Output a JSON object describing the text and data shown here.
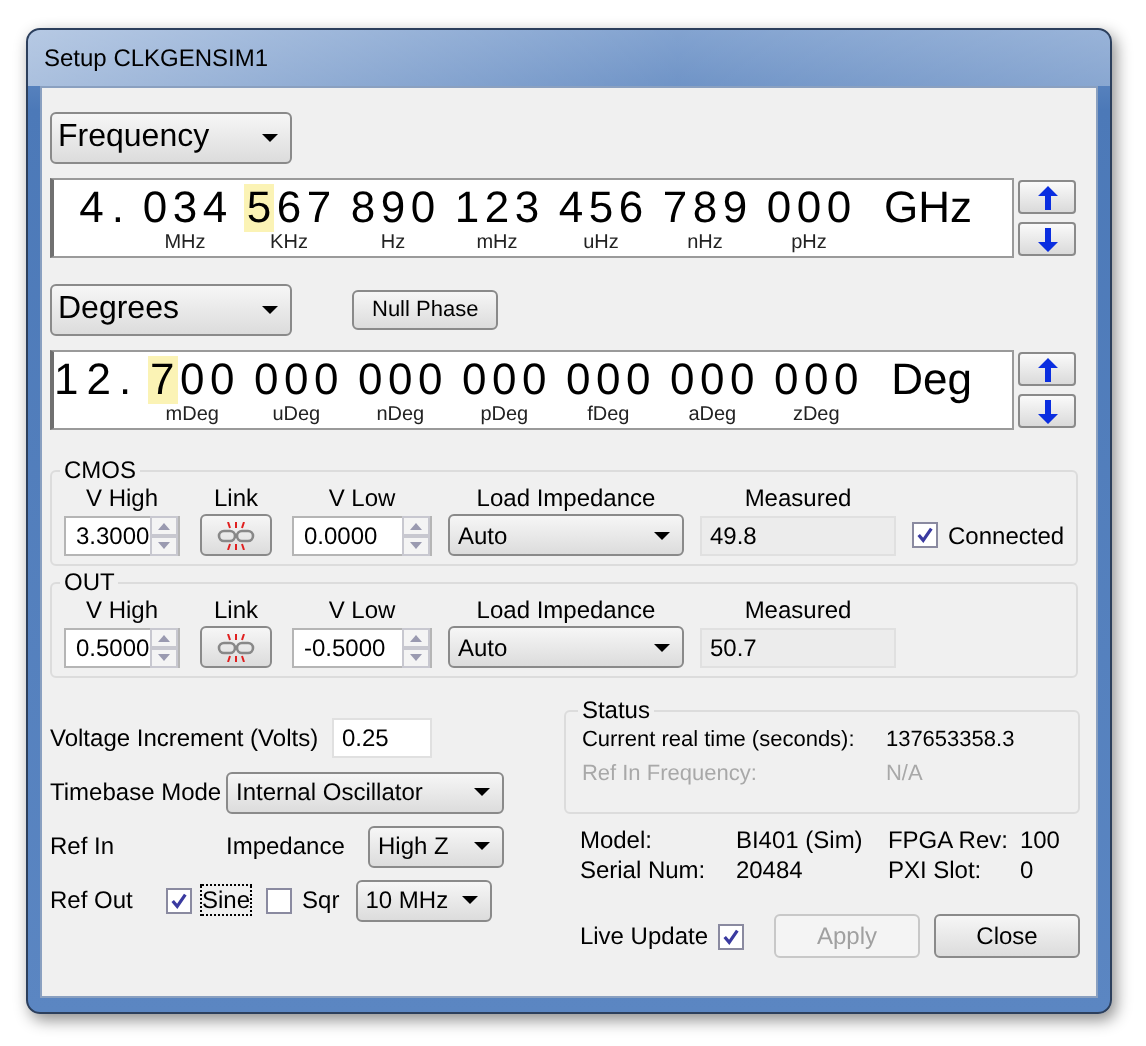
{
  "window": {
    "title": "Setup CLKGENSIM1"
  },
  "frequency": {
    "mode": "Frequency",
    "display": {
      "lead": "4.",
      "suffix": "GHz",
      "groups": [
        {
          "unit": "MHz",
          "digits": [
            {
              "d": "0",
              "selected": false
            },
            {
              "d": "3",
              "selected": false
            },
            {
              "d": "4",
              "selected": false
            }
          ]
        },
        {
          "unit": "KHz",
          "digits": [
            {
              "d": "5",
              "selected": true
            },
            {
              "d": "6",
              "selected": false
            },
            {
              "d": "7",
              "selected": false
            }
          ]
        },
        {
          "unit": "Hz",
          "digits": [
            {
              "d": "8",
              "selected": false
            },
            {
              "d": "9",
              "selected": false
            },
            {
              "d": "0",
              "selected": false
            }
          ]
        },
        {
          "unit": "mHz",
          "digits": [
            {
              "d": "1",
              "selected": false
            },
            {
              "d": "2",
              "selected": false
            },
            {
              "d": "3",
              "selected": false
            }
          ]
        },
        {
          "unit": "uHz",
          "digits": [
            {
              "d": "4",
              "selected": false
            },
            {
              "d": "5",
              "selected": false
            },
            {
              "d": "6",
              "selected": false
            }
          ]
        },
        {
          "unit": "nHz",
          "digits": [
            {
              "d": "7",
              "selected": false
            },
            {
              "d": "8",
              "selected": false
            },
            {
              "d": "9",
              "selected": false
            }
          ]
        },
        {
          "unit": "pHz",
          "digits": [
            {
              "d": "0",
              "selected": false
            },
            {
              "d": "0",
              "selected": false
            },
            {
              "d": "0",
              "selected": false
            }
          ]
        }
      ]
    }
  },
  "phase": {
    "mode": "Degrees",
    "null_button": "Null Phase",
    "display": {
      "lead": "12.",
      "suffix": "Deg",
      "groups": [
        {
          "unit": "mDeg",
          "digits": [
            {
              "d": "7",
              "selected": true
            },
            {
              "d": "0",
              "selected": false
            },
            {
              "d": "0",
              "selected": false
            }
          ]
        },
        {
          "unit": "uDeg",
          "digits": [
            {
              "d": "0",
              "selected": false
            },
            {
              "d": "0",
              "selected": false
            },
            {
              "d": "0",
              "selected": false
            }
          ]
        },
        {
          "unit": "nDeg",
          "digits": [
            {
              "d": "0",
              "selected": false
            },
            {
              "d": "0",
              "selected": false
            },
            {
              "d": "0",
              "selected": false
            }
          ]
        },
        {
          "unit": "pDeg",
          "digits": [
            {
              "d": "0",
              "selected": false
            },
            {
              "d": "0",
              "selected": false
            },
            {
              "d": "0",
              "selected": false
            }
          ]
        },
        {
          "unit": "fDeg",
          "digits": [
            {
              "d": "0",
              "selected": false
            },
            {
              "d": "0",
              "selected": false
            },
            {
              "d": "0",
              "selected": false
            }
          ]
        },
        {
          "unit": "aDeg",
          "digits": [
            {
              "d": "0",
              "selected": false
            },
            {
              "d": "0",
              "selected": false
            },
            {
              "d": "0",
              "selected": false
            }
          ]
        },
        {
          "unit": "zDeg",
          "digits": [
            {
              "d": "0",
              "selected": false
            },
            {
              "d": "0",
              "selected": false
            },
            {
              "d": "0",
              "selected": false
            }
          ]
        }
      ]
    }
  },
  "channels": [
    {
      "name": "CMOS",
      "v_high_label": "V High",
      "v_high": "3.3000",
      "link_label": "Link",
      "v_low_label": "V Low",
      "v_low": "0.0000",
      "load_label": "Load Impedance",
      "load": "Auto",
      "measured_label": "Measured",
      "measured": "49.8",
      "connected": {
        "label": "Connected",
        "checked": true
      }
    },
    {
      "name": "OUT",
      "v_high_label": "V High",
      "v_high": "0.5000",
      "link_label": "Link",
      "v_low_label": "V Low",
      "v_low": "-0.5000",
      "load_label": "Load Impedance",
      "load": "Auto",
      "measured_label": "Measured",
      "measured": "50.7"
    }
  ],
  "voltage_increment": {
    "label": "Voltage Increment (Volts)",
    "value": "0.25"
  },
  "timebase": {
    "label": "Timebase Mode",
    "value": "Internal Oscillator"
  },
  "ref_in": {
    "label": "Ref In",
    "impedance_label": "Impedance",
    "impedance": "High Z"
  },
  "ref_out": {
    "label": "Ref Out",
    "frequency": "10 MHz",
    "options": [
      {
        "label": "Sine",
        "checked": true,
        "focused": true
      },
      {
        "label": "Sqr",
        "checked": false,
        "focused": false
      }
    ]
  },
  "status": {
    "title": "Status",
    "rows": [
      {
        "label": "Current real time (seconds):",
        "value": "137653358.3",
        "disabled": false
      },
      {
        "label": "Ref In Frequency:",
        "value": "N/A",
        "disabled": true
      }
    ]
  },
  "info": [
    [
      {
        "label": "Model:",
        "value": "BI401 (Sim)"
      },
      {
        "label": "FPGA Rev:",
        "value": "100"
      }
    ],
    [
      {
        "label": "Serial Num:",
        "value": "20484"
      },
      {
        "label": "PXI Slot:",
        "value": "0"
      }
    ]
  ],
  "live_update": {
    "label": "Live Update",
    "checked": true
  },
  "buttons": [
    {
      "label": "Apply",
      "disabled": true
    },
    {
      "label": "Close",
      "disabled": false
    }
  ]
}
